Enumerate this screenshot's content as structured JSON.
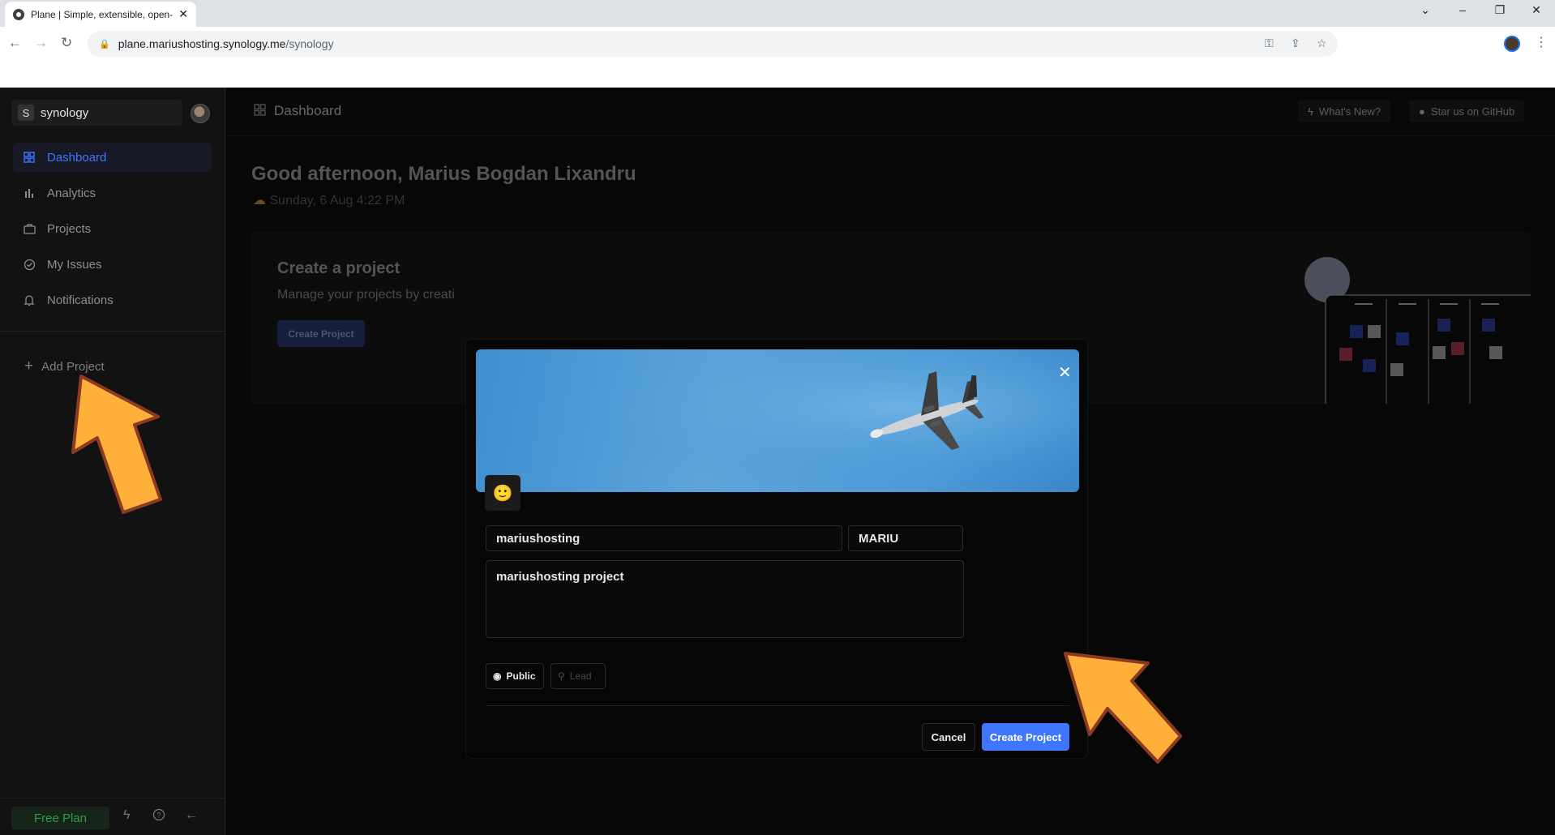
{
  "browser": {
    "tab_title": "Plane | Simple, extensible, open-",
    "url_host": "plane.mariushosting.synology.me",
    "url_path": "/synology"
  },
  "workspace": {
    "badge": "S",
    "name": "synology"
  },
  "sidebar": {
    "items": [
      {
        "label": "Dashboard",
        "icon": "grid-icon",
        "active": true
      },
      {
        "label": "Analytics",
        "icon": "bar-chart-icon"
      },
      {
        "label": "Projects",
        "icon": "briefcase-icon"
      },
      {
        "label": "My Issues",
        "icon": "check-circle-icon"
      },
      {
        "label": "Notifications",
        "icon": "bell-icon"
      }
    ],
    "add_project": "Add Project",
    "free_plan": "Free Plan"
  },
  "topbar": {
    "title": "Dashboard",
    "whats_new": "What's New?",
    "github": "Star us on GitHub"
  },
  "dashboard": {
    "greeting": "Good afternoon, Marius Bogdan Lixandru",
    "date": "Sunday, 6 Aug 4:22 PM",
    "hero_title": "Create a project",
    "hero_subtitle": "Manage your projects by creati",
    "hero_button": "Create Project"
  },
  "modal": {
    "emoji": "🙂",
    "name_value": "mariushosting",
    "identifier_value": "MARIU",
    "description_value": "mariushosting project",
    "network_label": "Public",
    "lead_label": "Lead",
    "cancel": "Cancel",
    "create": "Create Project"
  },
  "colors": {
    "accent": "#3f76ff",
    "arrow": "#ffb03b",
    "free_plan": "#2c9e4a"
  }
}
